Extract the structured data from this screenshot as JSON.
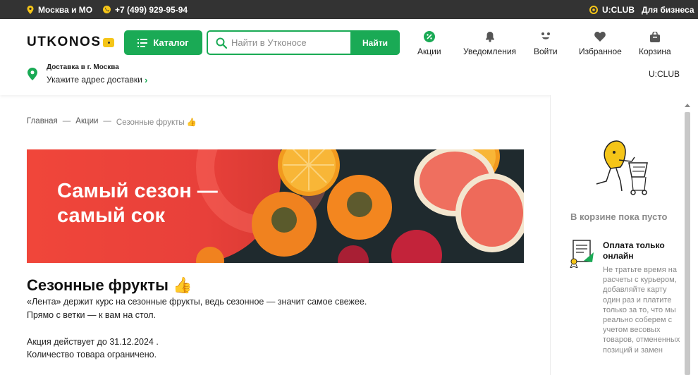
{
  "topbar": {
    "region": "Москва и МО",
    "phone": "+7 (499) 929-95-94",
    "uclub": "U:CLUB",
    "business": "Для бизнеса"
  },
  "header": {
    "logo": "UTKONOS",
    "catalog_label": "Каталог",
    "search_placeholder": "Найти в Утконосе",
    "search_button": "Найти",
    "nav": {
      "promos": "Акции",
      "notifications": "Уведомления",
      "login": "Войти",
      "favorites": "Избранное",
      "cart": "Корзина"
    },
    "delivery_title": "Доставка в г. Москва",
    "delivery_address": "Укажите адрес доставки",
    "uclub_link": "U:CLUB"
  },
  "breadcrumb": {
    "home": "Главная",
    "promos": "Акции",
    "current": "Сезонные фрукты 👍",
    "separator": "—"
  },
  "banner": {
    "line1": "Самый сезон —",
    "line2": "самый сок"
  },
  "main": {
    "title": "Сезонные фрукты 👍",
    "desc1": "«Лента» держит курс на сезонные фрукты, ведь сезонное — значит самое свежее.",
    "desc2": "Прямо с ветки — к вам на стол.",
    "valid_until": "Акция действует до 31.12.2024 .",
    "limited": "Количество товара ограничено."
  },
  "sidebar": {
    "cart_empty": "В корзине пока пусто",
    "promo_title": "Оплата только онлайн",
    "promo_text": "Не тратьте время на расчеты с курьером, добавляйте карту один раз и платите только за то, что мы реально соберем с учетом весовых товаров, отмененных позиций и замен"
  },
  "colors": {
    "accent": "#1aaa55",
    "topbar": "#333333",
    "brand_yellow": "#f5c518",
    "banner_red": "#f0463a"
  }
}
